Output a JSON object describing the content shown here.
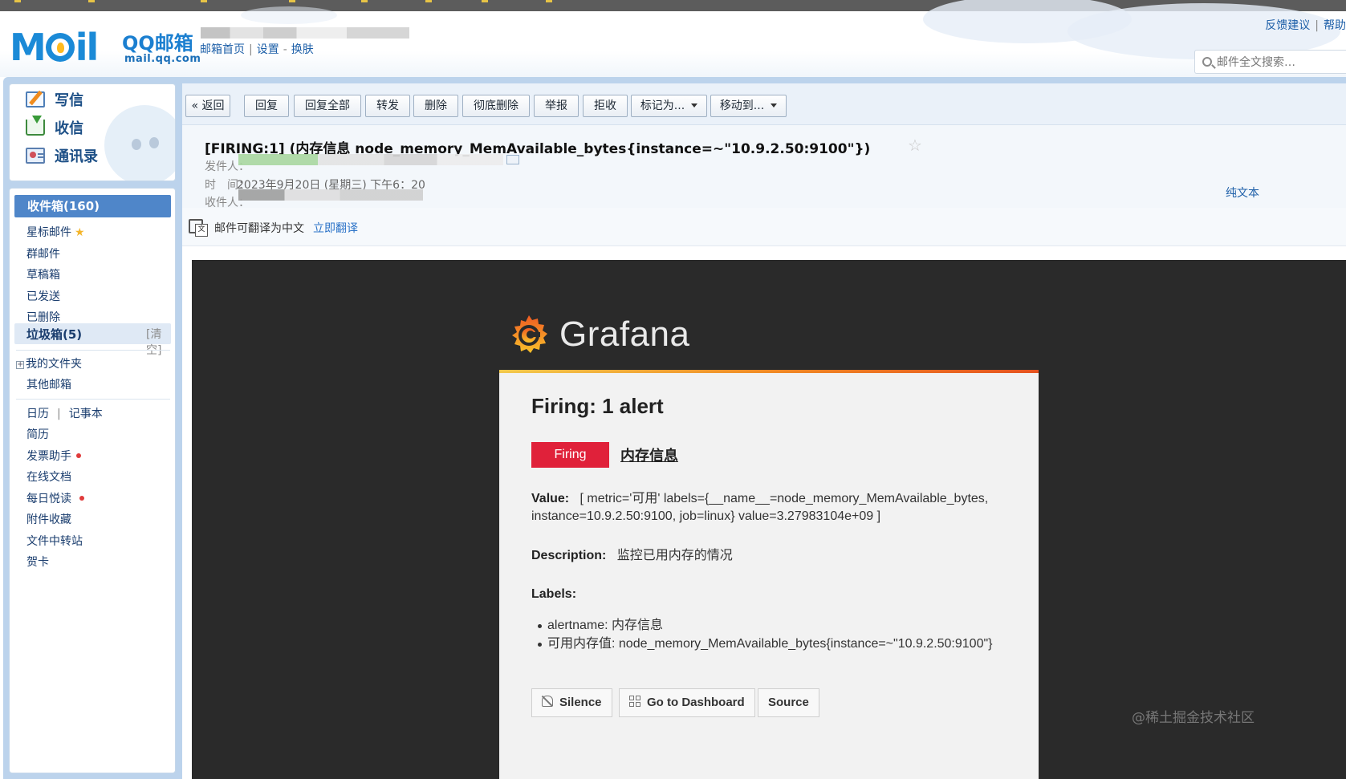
{
  "header": {
    "logo_text": "M",
    "logo_tail": "il",
    "logo_qq": "QQ邮箱",
    "logo_domain": "mail.qq.com",
    "nav": {
      "home": "邮箱首页",
      "settings": "设置",
      "skin": "换肤"
    },
    "top_right": {
      "feedback": "反馈建议",
      "help": "帮助"
    },
    "search_placeholder": "邮件全文搜索…"
  },
  "sidebar": {
    "compose": "写信",
    "inbox_action": "收信",
    "contacts": "通讯录",
    "folders": {
      "inbox": "收件箱(160)",
      "starred": "星标邮件",
      "group": "群邮件",
      "drafts": "草稿箱",
      "sent": "已发送",
      "deleted": "已删除",
      "trash": "垃圾箱(5)",
      "trash_clear": "[清空]",
      "my_folders": "我的文件夹",
      "other": "其他邮箱",
      "calendar": "日历",
      "notebook": "记事本",
      "resume": "简历",
      "invoice": "发票助手",
      "docs": "在线文档",
      "daily_read": "每日悦读",
      "attachments": "附件收藏",
      "transfer": "文件中转站",
      "cards": "贺卡"
    }
  },
  "toolbar": {
    "back": "« 返回",
    "reply": "回复",
    "reply_all": "回复全部",
    "forward": "转发",
    "delete": "删除",
    "delete_perm": "彻底删除",
    "report": "举报",
    "reject": "拒收",
    "mark_as": "标记为...",
    "move_to": "移动到..."
  },
  "email": {
    "subject": "[FIRING:1] (内存信息 node_memory_MemAvailable_bytes{instance=~\"10.9.2.50:9100\"})",
    "from_label": "发件人：",
    "time_label": "时　间：",
    "time_value": "2023年9月20日 (星期三) 下午6：20",
    "to_label": "收件人：",
    "plain_text": "纯文本",
    "translate_text": "邮件可翻译为中文",
    "translate_link": "立即翻译"
  },
  "grafana": {
    "brand": "Grafana",
    "title": "Firing: 1 alert",
    "badge": "Firing",
    "alert_name": "内存信息",
    "value_label": "Value:",
    "value_text": "[ metric='可用' labels={__name__=node_memory_MemAvailable_bytes,",
    "value_text2": "instance=10.9.2.50:9100, job=linux} value=3.27983104e+09 ]",
    "desc_label": "Description:",
    "desc_text": "监控已用内存的情况",
    "labels_label": "Labels:",
    "labels": [
      "alertname: 内存信息",
      "可用内存值: node_memory_MemAvailable_bytes{instance=~\"10.9.2.50:9100\"}"
    ],
    "btn_silence": "Silence",
    "btn_dashboard": "Go to Dashboard",
    "btn_source": "Source"
  },
  "watermark": "@稀土掘金技术社区",
  "colors": {
    "brand_blue": "#1b8ad7",
    "firing_red": "#e0213a",
    "grafana_orange": "#f08a24"
  }
}
